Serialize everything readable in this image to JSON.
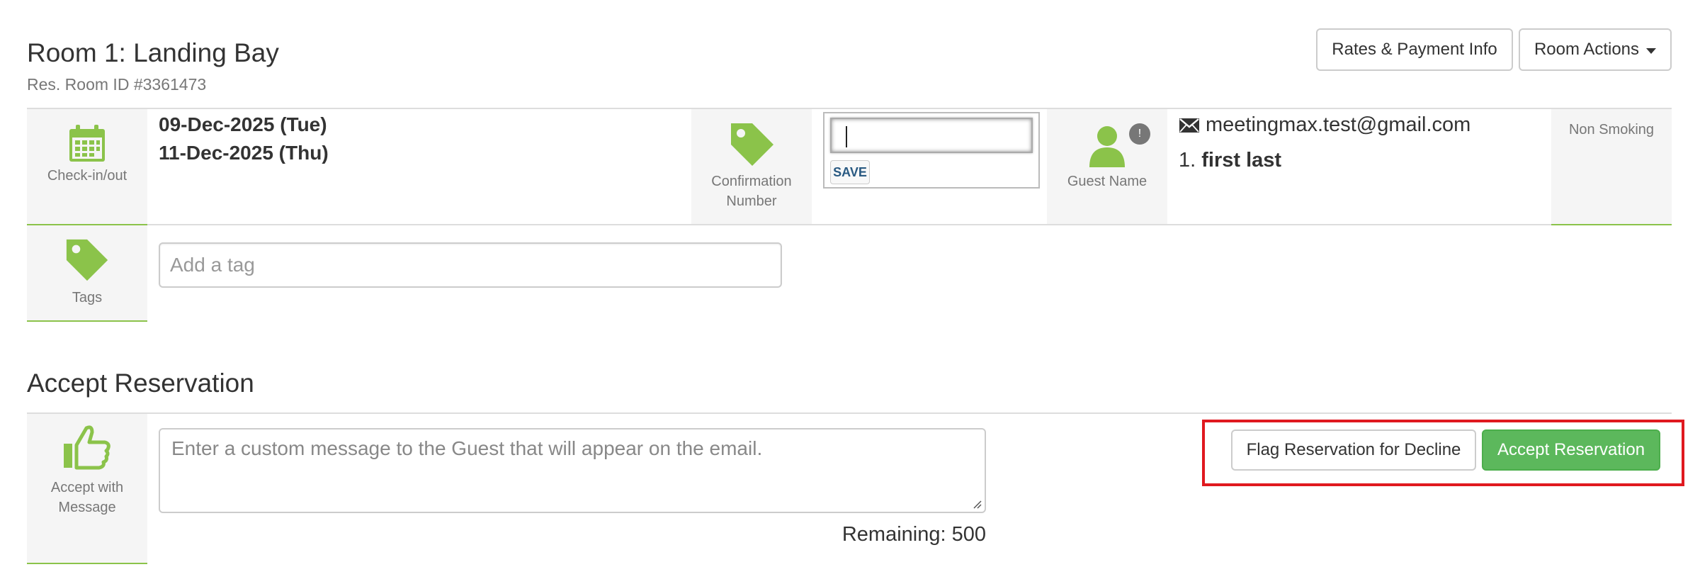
{
  "header": {
    "room_title": "Room 1: Landing Bay",
    "room_id": "Res. Room ID #3361473",
    "rates_button": "Rates & Payment Info",
    "room_actions_button": "Room Actions"
  },
  "details": {
    "checkin_label": "Check-in/out",
    "checkin_date": "09-Dec-2025 (Tue)",
    "checkout_date": "11-Dec-2025 (Thu)",
    "confirmation_label_line1": "Confirmation",
    "confirmation_label_line2": "Number",
    "confirmation_value": "",
    "save_label": "SAVE",
    "guest_label": "Guest Name",
    "guest_badge": "!",
    "guest_email": "meetingmax.test@gmail.com",
    "guest_index": "1.",
    "guest_name": "first last",
    "smoking": "Non Smoking"
  },
  "tags": {
    "label": "Tags",
    "placeholder": "Add a tag"
  },
  "accept": {
    "section_title": "Accept Reservation",
    "label_line1": "Accept with",
    "label_line2": "Message",
    "message_placeholder": "Enter a custom message to the Guest that will appear on the email.",
    "remaining": "Remaining: 500",
    "flag_button": "Flag Reservation for Decline",
    "accept_button": "Accept Reservation"
  },
  "colors": {
    "accent_green": "#8bc34a",
    "success_button": "#5cb85c",
    "highlight_red": "#e0191f"
  },
  "icons": [
    "calendar-icon",
    "tag-icon",
    "user-icon",
    "envelope-icon",
    "thumbs-up-icon",
    "caret-down-icon"
  ]
}
